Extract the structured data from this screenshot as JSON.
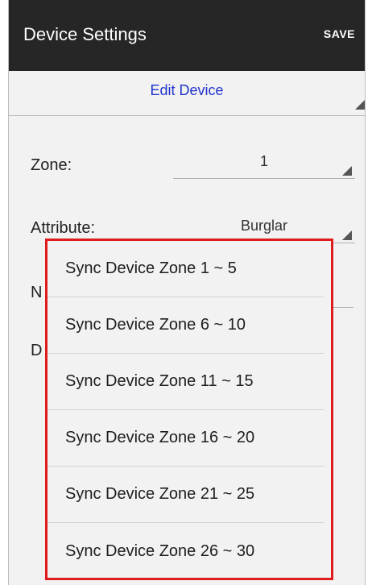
{
  "action_bar": {
    "title": "Device Settings",
    "save_label": "SAVE"
  },
  "edit_device": {
    "label": "Edit Device"
  },
  "form": {
    "zone": {
      "label": "Zone:",
      "value": "1"
    },
    "attribute": {
      "label": "Attribute:",
      "value": "Burglar"
    },
    "name": {
      "label_partial": "N"
    },
    "device": {
      "label_partial": "D"
    }
  },
  "dropdown": {
    "items": [
      {
        "label": "Sync Device Zone 1 ~ 5"
      },
      {
        "label": "Sync Device Zone 6 ~ 10"
      },
      {
        "label": "Sync Device Zone 11 ~ 15"
      },
      {
        "label": "Sync Device Zone 16 ~ 20"
      },
      {
        "label": "Sync Device Zone 21 ~ 25"
      },
      {
        "label": "Sync Device Zone 26 ~ 30"
      }
    ]
  },
  "colors": {
    "action_bar_bg": "#262626",
    "edit_device_text": "#2233cc",
    "highlight_border": "#e01b1b"
  }
}
